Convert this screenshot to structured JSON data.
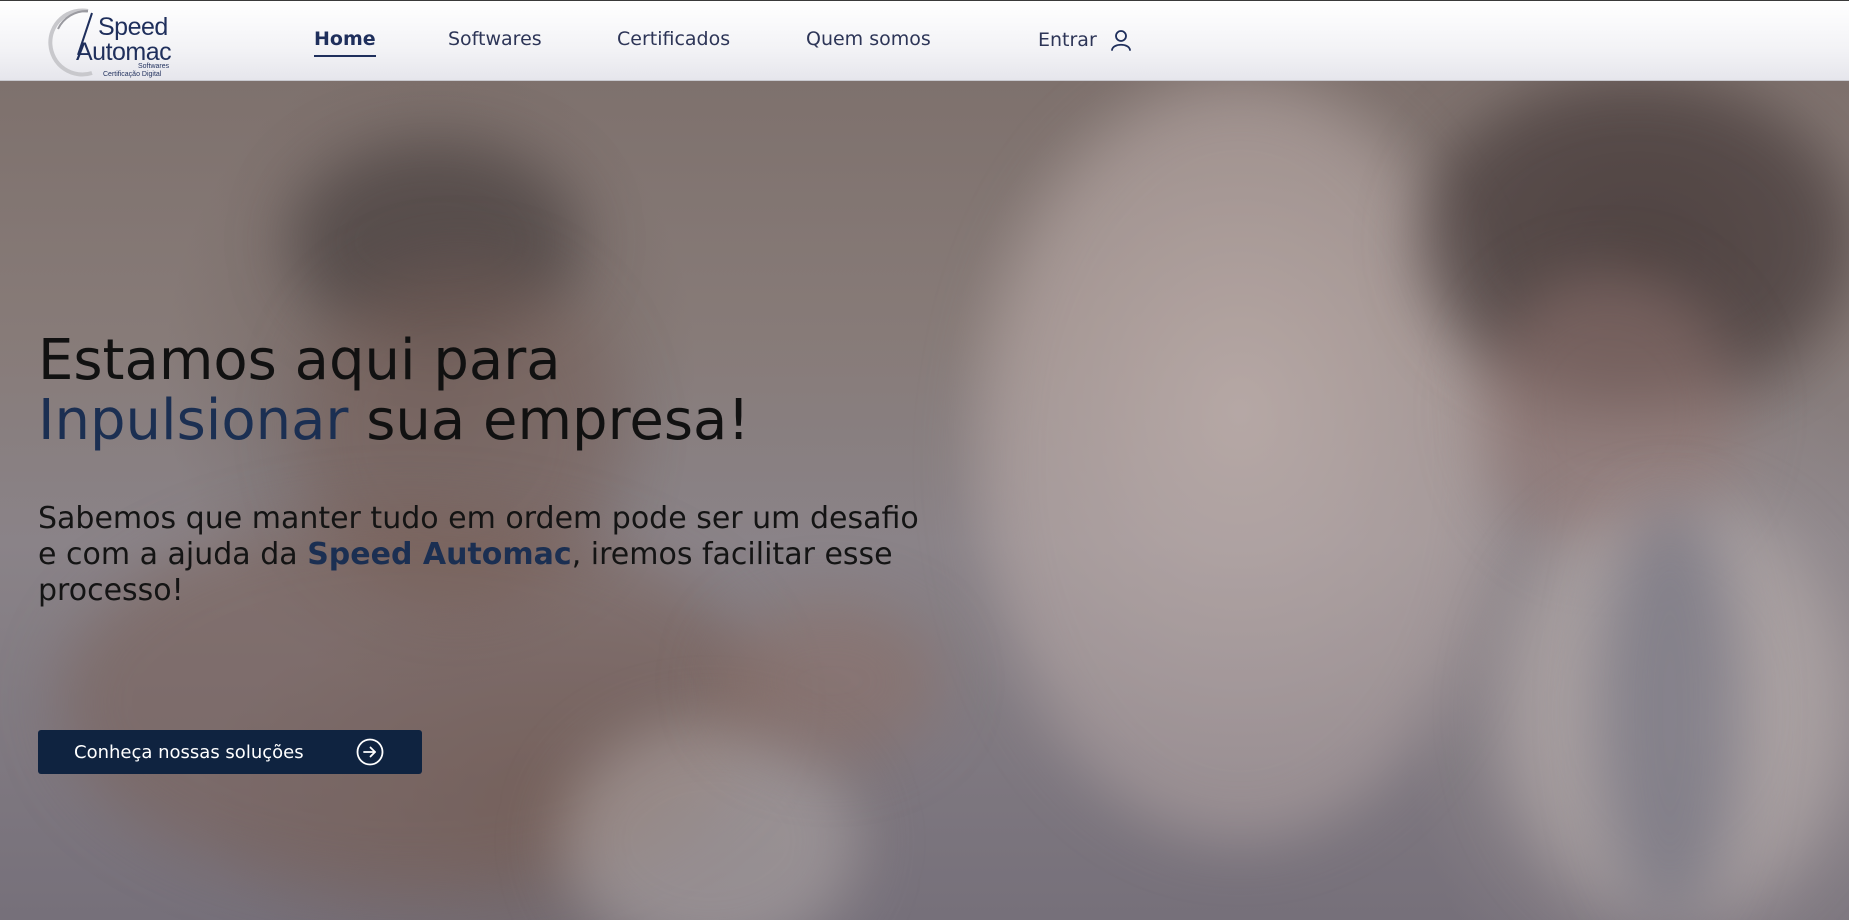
{
  "logo": {
    "line1": "Speed",
    "line2": "Automac",
    "sub1": "Softwares",
    "sub2": "Certificação Digital"
  },
  "nav": {
    "items": [
      {
        "label": "Home",
        "active": true
      },
      {
        "label": "Softwares",
        "active": false
      },
      {
        "label": "Certificados",
        "active": false
      },
      {
        "label": "Quem somos",
        "active": false
      }
    ],
    "login_label": "Entrar",
    "login_icon": "user-icon"
  },
  "hero": {
    "title_line1": "Estamos aqui para",
    "title_accent": "Inpulsionar",
    "title_rest": " sua empresa!",
    "subtitle_before": "Sabemos que manter tudo em ordem pode ser um desafio e com a ajuda da ",
    "subtitle_brand": "Speed Automac",
    "subtitle_after": ", iremos facilitar esse processo!",
    "cta_label": "Conheça nossas soluções",
    "cta_icon": "arrow-right-circle-icon"
  },
  "colors": {
    "brand_dark": "#0f2340",
    "accent_text": "#1b2f52",
    "nav_text": "#2d3557"
  }
}
